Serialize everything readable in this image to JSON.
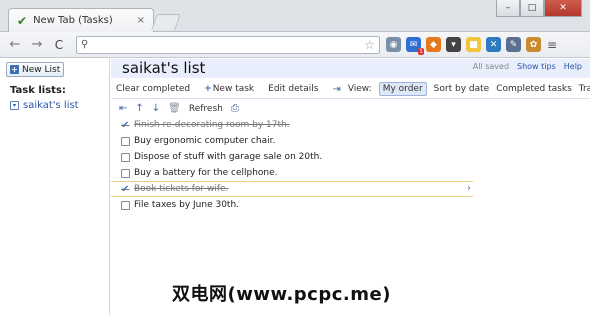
{
  "browser": {
    "tab_title": "New Tab (Tasks)",
    "tab_close": "×",
    "win_min": "–",
    "win_max": "□",
    "win_close": "✕",
    "back": "←",
    "forward": "→",
    "reload": "C",
    "search_glyph": "⚲",
    "star": "☆",
    "menu": "≡",
    "extension_badge": "1",
    "extensions": [
      "globe-icon",
      "mail-icon",
      "fire-icon",
      "pocket-icon",
      "lock-icon",
      "x-icon",
      "dropper-icon",
      "basket-icon"
    ]
  },
  "app": {
    "new_list_label": "New List",
    "task_lists_label": "Task lists:",
    "lists": [
      {
        "name": "saikat's list"
      }
    ],
    "list_title": "saikat's list",
    "status": {
      "saved": "All saved",
      "show_tips": "Show tips",
      "help": "Help"
    },
    "toolbar": {
      "clear_completed": "Clear completed",
      "new_task": "New task",
      "edit_details": "Edit details",
      "view_label": "View:",
      "my_order": "My order",
      "sort_by_date": "Sort by date",
      "completed_tasks": "Completed tasks",
      "trash": "Trash",
      "refresh": "Refresh"
    },
    "tasks": [
      {
        "text": "Finish re-decorating room by 17th.",
        "done": true
      },
      {
        "text": "Buy ergonomic computer chair.",
        "done": false
      },
      {
        "text": "Dispose of stuff with garage sale on 20th.",
        "done": false
      },
      {
        "text": "Buy a battery for the cellphone.",
        "done": false
      },
      {
        "text": "Book tickets for wife.",
        "done": true
      },
      {
        "text": "File taxes by June 30th.",
        "done": false
      }
    ]
  },
  "watermark": "双电网(www.pcpc.me)"
}
